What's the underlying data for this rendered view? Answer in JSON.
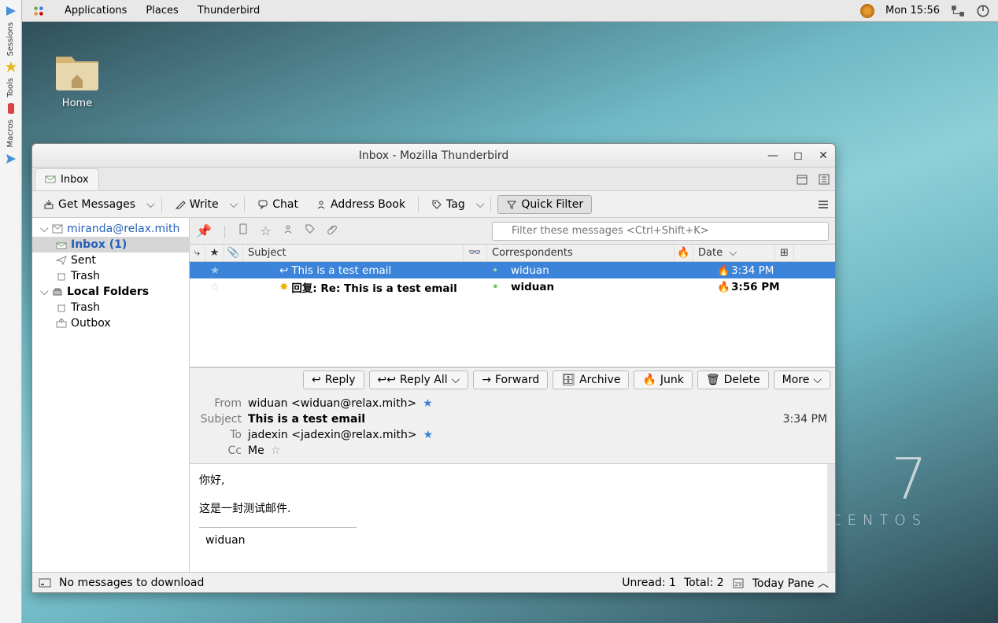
{
  "topbar": {
    "menus": [
      "Applications",
      "Places",
      "Thunderbird"
    ],
    "clock": "Mon 15:56"
  },
  "leftdock": {
    "groups": [
      "Sessions",
      "Tools",
      "Macros"
    ]
  },
  "desktop": {
    "home_label": "Home"
  },
  "watermark": {
    "seven": "7",
    "name": "CENTOS"
  },
  "window": {
    "title": "Inbox - Mozilla Thunderbird",
    "tab": "Inbox",
    "toolbar": {
      "get": "Get Messages",
      "write": "Write",
      "chat": "Chat",
      "address": "Address Book",
      "tag": "Tag",
      "quickfilter": "Quick Filter"
    },
    "filter_placeholder": "Filter these messages <Ctrl+Shift+K>",
    "folders": {
      "account": "miranda@relax.mith",
      "inbox": "Inbox (1)",
      "sent": "Sent",
      "trash": "Trash",
      "local": "Local Folders",
      "local_trash": "Trash",
      "outbox": "Outbox"
    },
    "columns": {
      "subject": "Subject",
      "correspondents": "Correspondents",
      "date": "Date"
    },
    "messages": [
      {
        "subject": "This is a test email",
        "from": "widuan",
        "date": "3:34 PM",
        "selected": true,
        "unread": false,
        "reply": true
      },
      {
        "subject": "回复: Re: This is a test email",
        "from": "widuan",
        "date": "3:56 PM",
        "selected": false,
        "unread": true,
        "reply": false
      }
    ],
    "actions": {
      "reply": "Reply",
      "replyall": "Reply All",
      "forward": "Forward",
      "archive": "Archive",
      "junk": "Junk",
      "delete": "Delete",
      "more": "More"
    },
    "header": {
      "from_label": "From",
      "from_value": "widuan <widuan@relax.mith>",
      "subject_label": "Subject",
      "subject_value": "This is a test email",
      "time": "3:34 PM",
      "to_label": "To",
      "to_value": "jadexin <jadexin@relax.mith>",
      "cc_label": "Cc",
      "cc_value": "Me"
    },
    "body": {
      "line1": "你好,",
      "line2": "这是一封测试邮件.",
      "sig": "widuan"
    },
    "status": {
      "left": "No messages to download",
      "unread": "Unread: 1",
      "total": "Total: 2",
      "today": "Today Pane"
    }
  }
}
